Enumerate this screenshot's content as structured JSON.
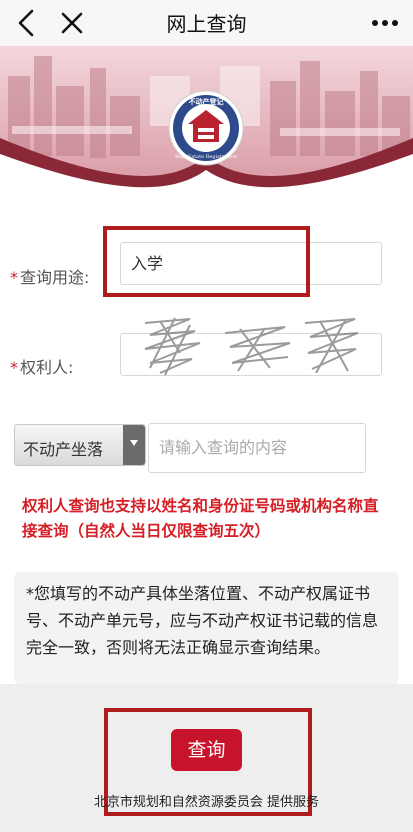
{
  "nav": {
    "title": "网上查询"
  },
  "logo": {
    "top_text": "不动产登记",
    "ring_text": "Real Estate Registration"
  },
  "form": {
    "purpose": {
      "label": "查询用途:",
      "value": "入学"
    },
    "owner": {
      "label": "权利人:",
      "value": ""
    },
    "location": {
      "select_value": "不动产坐落",
      "placeholder": "请输入查询的内容"
    }
  },
  "notice": "权利人查询也支持以姓名和身份证号码或机构名称直接查询（自然人当日仅限查询五次）",
  "info": "*您填写的不动产具体坐落位置、不动产权属证书 号、不动产单元号，应与不动产权证书记载的信息完全一致，否则将无法正确显示查询结果。",
  "query_button": "查询",
  "footer": "北京市规划和自然资源委员会 提供服务",
  "colors": {
    "accent": "#c8142b",
    "highlight_box": "#b01b1d",
    "notice_red": "#d51f26"
  }
}
